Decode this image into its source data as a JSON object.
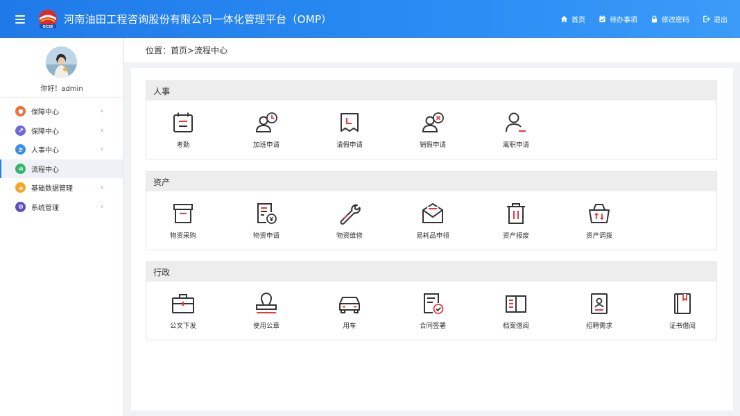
{
  "header": {
    "title": "河南油田工程咨询股份有限公司一体化管理平台（OMP）",
    "logo_text": "OCSE",
    "nav": [
      {
        "label": "首页",
        "icon": "home-icon"
      },
      {
        "label": "待办事项",
        "icon": "todo-icon"
      },
      {
        "label": "修改密码",
        "icon": "lock-icon"
      },
      {
        "label": "退出",
        "icon": "logout-icon"
      }
    ]
  },
  "sidebar": {
    "greeting": "你好！admin",
    "items": [
      {
        "label": "保障中心",
        "icon": "shield-icon",
        "color": "#f26b3a",
        "active": false,
        "has_children": true
      },
      {
        "label": "保障中心",
        "icon": "rocket-icon",
        "color": "#6c6ad8",
        "active": false,
        "has_children": true
      },
      {
        "label": "人事中心",
        "icon": "people-icon",
        "color": "#3a8ee6",
        "active": false,
        "has_children": true
      },
      {
        "label": "流程中心",
        "icon": "flow-icon",
        "color": "#34b36b",
        "active": true,
        "has_children": false
      },
      {
        "label": "基础数据管理",
        "icon": "chart-icon",
        "color": "#f5a623",
        "active": false,
        "has_children": true
      },
      {
        "label": "系统管理",
        "icon": "settings-icon",
        "color": "#5b4fbf",
        "active": false,
        "has_children": true
      }
    ]
  },
  "breadcrumb": {
    "text": "位置：首页>流程中心"
  },
  "sections": [
    {
      "title": "人事",
      "items": [
        {
          "label": "考勤",
          "icon": "calendar-icon"
        },
        {
          "label": "加班申请",
          "icon": "user-clock-icon"
        },
        {
          "label": "请假申请",
          "icon": "leave-icon"
        },
        {
          "label": "销假申请",
          "icon": "user-cancel-icon"
        },
        {
          "label": "离职申请",
          "icon": "user-minus-icon"
        }
      ]
    },
    {
      "title": "资产",
      "items": [
        {
          "label": "物资采购",
          "icon": "box-icon"
        },
        {
          "label": "物资申请",
          "icon": "document-icon"
        },
        {
          "label": "物资维修",
          "icon": "wrench-icon"
        },
        {
          "label": "易耗品申领",
          "icon": "envelope-icon"
        },
        {
          "label": "资产报废",
          "icon": "trash-icon"
        },
        {
          "label": "资产调拨",
          "icon": "basket-icon"
        }
      ]
    },
    {
      "title": "行政",
      "items": [
        {
          "label": "公文下发",
          "icon": "briefcase-icon"
        },
        {
          "label": "使用公章",
          "icon": "stamp-icon"
        },
        {
          "label": "用车",
          "icon": "car-icon"
        },
        {
          "label": "合同签署",
          "icon": "contract-icon"
        },
        {
          "label": "档案借阅",
          "icon": "archive-book-icon"
        },
        {
          "label": "招聘需求",
          "icon": "badge-icon"
        },
        {
          "label": "证书借阅",
          "icon": "certificate-icon"
        }
      ]
    }
  ],
  "colors": {
    "header": "#2a8cf4",
    "accent": "#2a7fe6",
    "icon_stroke": "#333333",
    "icon_highlight": "#e8363b"
  }
}
